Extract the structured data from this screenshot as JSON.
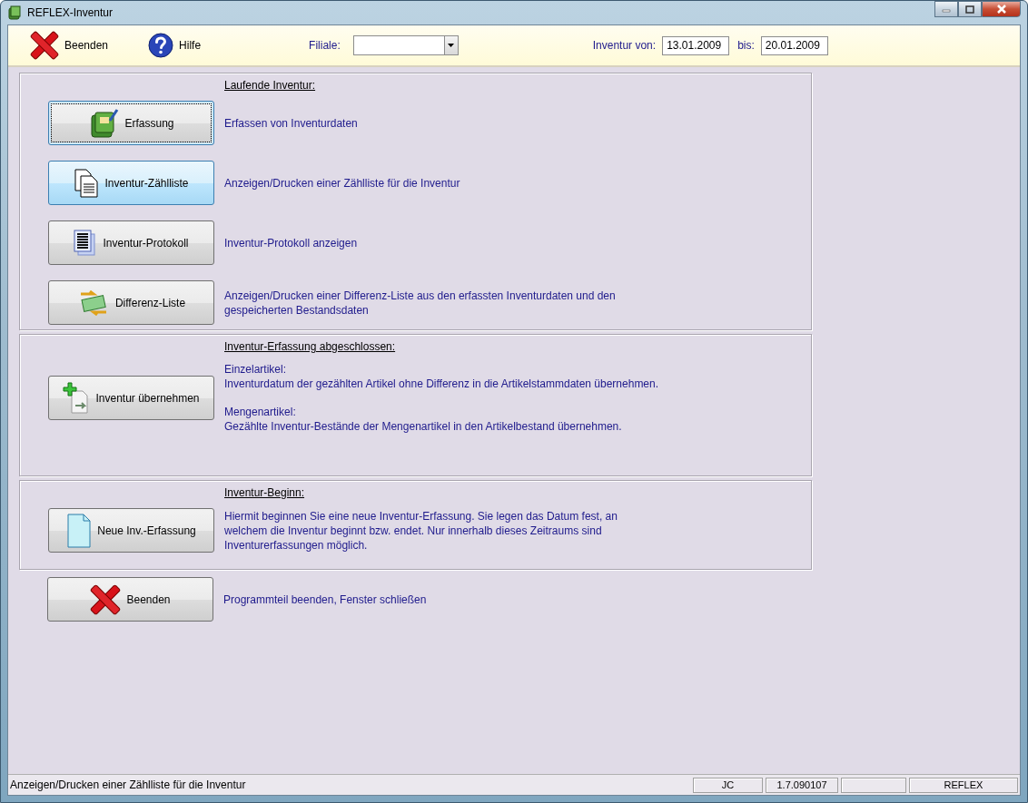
{
  "window": {
    "title": "REFLEX-Inventur"
  },
  "toolbar": {
    "buttons": [
      {
        "label": "Beenden",
        "kind": "close"
      },
      {
        "label": "Hilfe",
        "kind": "help"
      }
    ],
    "branch": {
      "label": "Filiale:"
    },
    "period": {
      "from_label": "Inventur von:",
      "from": "13.01.2009",
      "to_label": "bis:",
      "to": "20.01.2009"
    }
  },
  "sections": [
    {
      "heading": "Laufende Inventur:",
      "rows": [
        {
          "label": "Erfassung",
          "kind": "book",
          "focused": true,
          "highlighted": false,
          "paragraphs": [
            [
              "Erfassen von Inventurdaten"
            ]
          ]
        },
        {
          "label": "Inventur-Zählliste",
          "kind": "pages",
          "focused": false,
          "highlighted": true,
          "paragraphs": [
            [
              "Anzeigen/Drucken einer Zählliste für die Inventur"
            ]
          ]
        },
        {
          "label": "Inventur-Protokoll",
          "kind": "list",
          "focused": false,
          "highlighted": false,
          "paragraphs": [
            [
              "Inventur-Protokoll anzeigen"
            ]
          ]
        },
        {
          "label": "Differenz-Liste",
          "kind": "money",
          "focused": false,
          "highlighted": false,
          "paragraphs": [
            [
              "Anzeigen/Drucken einer Differenz-Liste aus den erfassten Inventurdaten und den",
              "gespeicherten Bestandsdaten"
            ]
          ]
        }
      ]
    },
    {
      "heading": "Inventur-Erfassung abgeschlossen:",
      "rows": [
        {
          "label": "Inventur übernehmen",
          "kind": "add",
          "focused": false,
          "highlighted": false,
          "paragraphs": [
            [
              "Einzelartikel:",
              "Inventurdatum der gezählten Artikel ohne Differenz in die Artikelstammdaten übernehmen."
            ],
            [
              "Mengenartikel:",
              "Gezählte Inventur-Bestände der Mengenartikel in den Artikelbestand übernehmen."
            ]
          ]
        }
      ]
    },
    {
      "heading": "Inventur-Beginn:",
      "rows": [
        {
          "label": "Neue Inv.-Erfassung",
          "kind": "doc",
          "focused": false,
          "highlighted": false,
          "paragraphs": [
            [
              "Hiermit beginnen Sie eine neue Inventur-Erfassung. Sie legen das Datum fest, an",
              "welchem die Inventur beginnt bzw. endet. Nur innerhalb dieses Zeitraums sind",
              "Inventurerfassungen möglich."
            ]
          ]
        }
      ]
    }
  ],
  "footer_row": {
    "label": "Beenden",
    "kind": "close",
    "focused": false,
    "highlighted": false,
    "paragraphs": [
      [
        "Programmteil beenden, Fenster schließen"
      ]
    ]
  },
  "status_bar": {
    "text": "Anzeigen/Drucken einer Zählliste für die Inventur",
    "panels": [
      {
        "kind": "text",
        "text": "JC"
      },
      {
        "kind": "text",
        "text": "1.7.090107"
      },
      {
        "kind": "blank"
      },
      {
        "kind": "text",
        "text": "REFLEX"
      }
    ]
  }
}
